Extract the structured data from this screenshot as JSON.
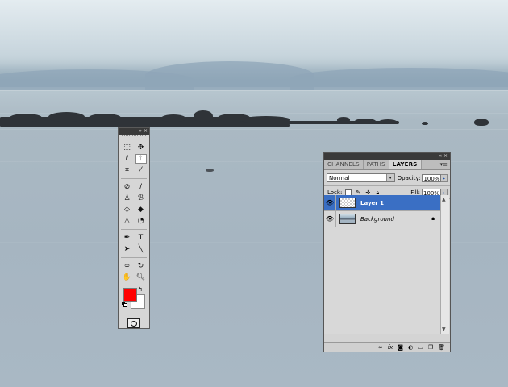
{
  "toolbox": {
    "rows": [
      [
        "marquee-icon",
        "move-icon"
      ],
      [
        "lasso-icon",
        "magic-wand-icon"
      ],
      [
        "crop-icon",
        "eyedropper-icon"
      ],
      [
        "healing-brush-icon",
        "brush-icon"
      ],
      [
        "clone-stamp-icon",
        "history-brush-icon"
      ],
      [
        "eraser-icon",
        "paint-bucket-icon"
      ],
      [
        "blur-icon",
        "dodge-icon"
      ],
      [
        "pen-icon",
        "type-icon"
      ],
      [
        "path-selection-icon",
        "line-icon"
      ],
      [
        "3d-rotate-icon",
        "3d-orbit-icon"
      ],
      [
        "hand-icon",
        "zoom-icon"
      ]
    ],
    "active_tool": "magic-wand-icon",
    "foreground_color": "#ff0000",
    "background_color": "#ffffff"
  },
  "layers_panel": {
    "tabs": [
      {
        "label": "CHANNELS",
        "active": false
      },
      {
        "label": "PATHS",
        "active": false
      },
      {
        "label": "LAYERS",
        "active": true
      }
    ],
    "blend_mode": "Normal",
    "opacity_label": "Opacity:",
    "opacity_value": "100%",
    "lock_label": "Lock:",
    "fill_label": "Fill:",
    "fill_value": "100%",
    "layers": [
      {
        "name": "Layer 1",
        "selected": true,
        "thumb": "transparent",
        "locked": false
      },
      {
        "name": "Background",
        "selected": false,
        "thumb": "photo",
        "locked": true
      }
    ],
    "footer_icons": [
      "link-layers-icon",
      "fx-icon",
      "add-mask-icon",
      "adjustment-layer-icon",
      "new-group-icon",
      "new-layer-icon",
      "trash-icon"
    ]
  }
}
